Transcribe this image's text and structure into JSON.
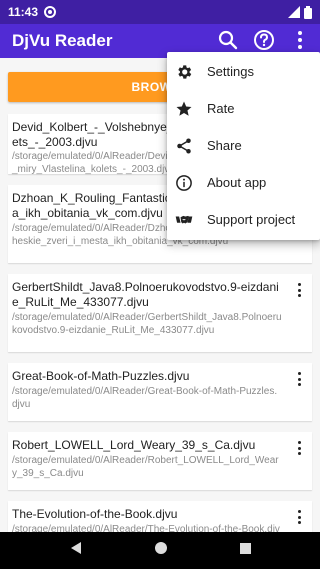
{
  "status": {
    "time": "11:43"
  },
  "appbar": {
    "title": "DjVu Reader"
  },
  "browse": {
    "label": "BROWSE"
  },
  "files": [
    {
      "name": "Devid_Kolbert_-_Volshebnye_miry_Vlastelina_kolets_-_2003.djvu",
      "path": "/storage/emulated/0/AlReader/Devid_Kolbert_-_Volshebnye_miry_Vlastelina_kolets_-_2003.djvu"
    },
    {
      "name": "Dzhoan_K_Rouling_Fantasticheskie_zveri_i_mesta_ikh_obitania_vk_com.djvu",
      "path": "/storage/emulated/0/AlReader/Dzhoan_K_Rouling_Fantasticheskie_zveri_i_mesta_ikh_obitania_vk_com.djvu"
    },
    {
      "name": "GerbertShildt_Java8.Polnoerukovodstvo.9-eizdanie_RuLit_Me_433077.djvu",
      "path": "/storage/emulated/0/AlReader/GerbertShildt_Java8.Polnoerukovodstvo.9-eizdanie_RuLit_Me_433077.djvu"
    },
    {
      "name": "Great-Book-of-Math-Puzzles.djvu",
      "path": "/storage/emulated/0/AlReader/Great-Book-of-Math-Puzzles.djvu"
    },
    {
      "name": "Robert_LOWELL_Lord_Weary_39_s_Ca.djvu",
      "path": "/storage/emulated/0/AlReader/Robert_LOWELL_Lord_Weary_39_s_Ca.djvu"
    },
    {
      "name": "The-Evolution-of-the-Book.djvu",
      "path": "/storage/emulated/0/AlReader/The-Evolution-of-the-Book.djvu"
    }
  ],
  "menu": [
    {
      "label": "Settings",
      "icon": "gear-icon"
    },
    {
      "label": "Rate",
      "icon": "star-icon"
    },
    {
      "label": "Share",
      "icon": "share-icon"
    },
    {
      "label": "About app",
      "icon": "info-icon"
    },
    {
      "label": "Support project",
      "icon": "handshake-icon"
    }
  ],
  "colors": {
    "appbar": "#512bd4",
    "statusbar": "#3f1fa3",
    "browse": "#ff9a1f"
  }
}
